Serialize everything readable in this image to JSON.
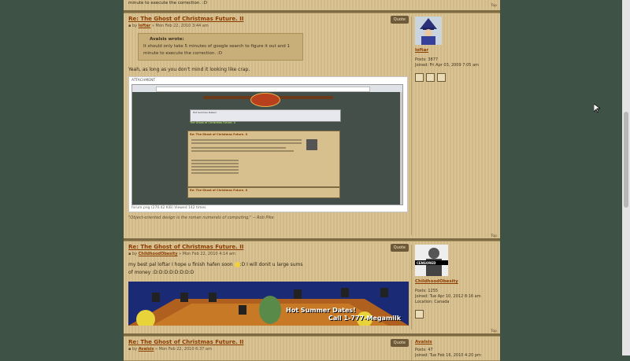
{
  "top_fragment": {
    "text": "minute to execute the correction. :D",
    "top_link": "Top"
  },
  "posts": [
    {
      "title": "Re: The Ghost of Christmas Future. II",
      "by": "by",
      "author": "loftar",
      "date": "» Mon Feb 22, 2010 3:44 am",
      "quote_label": "Quote",
      "quote": {
        "who": "Avalsis wrote:",
        "text1": "It should only take 5 minutes of google search to figure it out and 1",
        "text2": "minute to execute the correction. :D"
      },
      "text": "Yeah, as long as you don't mind it looking like crap.",
      "attachment": {
        "heading": "ATTACHMENT",
        "filename": "forum.png (270.42 KiB) Viewed 142 times"
      },
      "signature": "\"Object-oriented design is the roman numerals of computing.\" -- Rob Pike",
      "top_link": "Top",
      "sidebar": {
        "username": "loftar",
        "posts": "Posts: 3877",
        "joined": "Joined: Fri Apr 03, 2009 7:05 am"
      }
    },
    {
      "title": "Re: The Ghost of Christmas Future. II",
      "by": "by",
      "author": "ChildhoodObesity",
      "date": "» Mon Feb 22, 2010 4:14 am",
      "quote_label": "Quote",
      "text1": "my best pal loftar I hope u finish hafen soon",
      "text1b": ":D I will donit u large sums",
      "text2": "of money :D:D:D:D:D:D:D:D",
      "banner": {
        "line1": "Hot Summer Dates!",
        "line2": "Call 1-777-Megamilk"
      },
      "top_link": "Top",
      "sidebar": {
        "username": "ChildhoodObesity",
        "avatar_text": "CENSORED",
        "posts": "Posts: 1255",
        "joined": "Joined: Tue Apr 10, 2012 8:16 am",
        "location": "Location: Canada"
      }
    },
    {
      "title": "Re: The Ghost of Christmas Future. II",
      "by": "by",
      "author": "Avalsis",
      "date": "» Mon Feb 22, 2010 6:37 am",
      "quote_label": "Quote",
      "sidebar": {
        "username": "Avalsis",
        "posts": "Posts: 47",
        "joined": "Joined: Tue Feb 16, 2010 4:20 pm"
      }
    }
  ],
  "mini_screenshot": {
    "ad_title": "Hot Summer Dates!",
    "page_title": "The Ghost of Christmas Future. II",
    "post_title": "Re: The Ghost of Christmas Future. II",
    "post2_title": "Re: The Ghost of Christmas Future. II"
  },
  "colors": {
    "page_bg": "#3f5246",
    "post_bg": "#d8c08e",
    "link": "#8a3c00"
  }
}
